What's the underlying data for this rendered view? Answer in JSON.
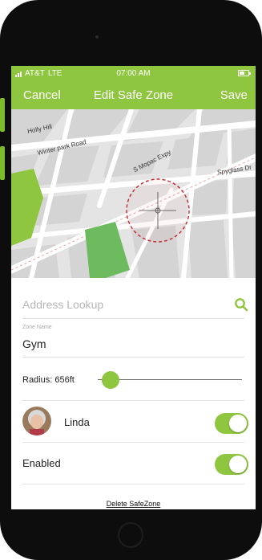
{
  "status_bar": {
    "carrier": "AT&T",
    "network": "LTE",
    "time": "07:00 AM"
  },
  "nav": {
    "cancel_label": "Cancel",
    "title": "Edit Safe Zone",
    "save_label": "Save"
  },
  "map": {
    "street_labels": [
      "Holly Hill",
      "Winter park Road",
      "S Mopac Expy",
      "Spyglass Dr"
    ],
    "colors": {
      "park": "#8fc63f",
      "green_area": "#6dbb5e",
      "zone_circle": "#c1272d"
    }
  },
  "form": {
    "address_placeholder": "Address Lookup",
    "address_value": "",
    "zone_name_label": "Zone Name",
    "zone_name_value": "Gym",
    "radius_label": "Radius: 656ft",
    "radius_slider_fraction": 0.09,
    "person": {
      "name": "Linda",
      "tracking_on": true
    },
    "enabled_label": "Enabled",
    "enabled_on": true,
    "delete_label": "Delete SafeZone"
  },
  "theme": {
    "accent": "#8fc63f"
  },
  "icons": {
    "search": "search-icon",
    "battery": "battery-icon",
    "signal": "signal-icon",
    "crosshair": "crosshair-icon"
  }
}
